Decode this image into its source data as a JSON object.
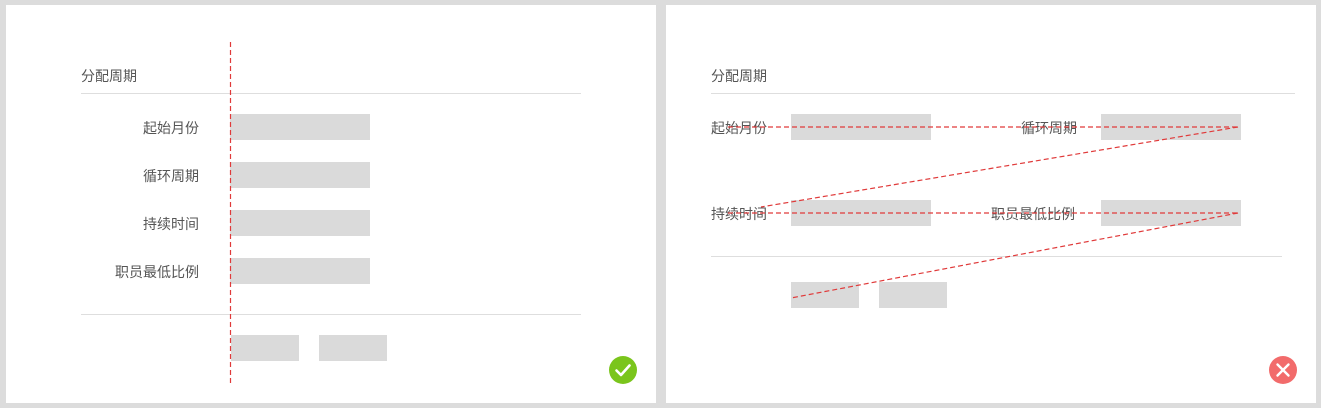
{
  "left_panel": {
    "section_title": "分配周期",
    "rows": [
      {
        "label": "起始月份"
      },
      {
        "label": "循环周期"
      },
      {
        "label": "持续时间"
      },
      {
        "label": "职员最低比例"
      }
    ],
    "badge": {
      "icon": "check-icon",
      "color": "#7ac51c"
    }
  },
  "right_panel": {
    "section_title": "分配周期",
    "row1": {
      "left_label": "起始月份",
      "right_label": "循环周期"
    },
    "row2": {
      "left_label": "持续时间",
      "right_label": "职员最低比例"
    },
    "badge": {
      "icon": "close-icon",
      "color": "#f26b6b"
    }
  },
  "guide_color": "#e03a3a"
}
